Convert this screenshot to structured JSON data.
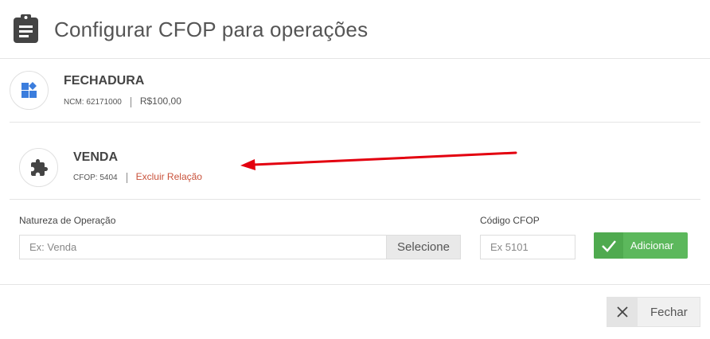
{
  "header": {
    "title": "Configurar CFOP para operações",
    "icon": "clipboard-icon"
  },
  "product": {
    "name": "FECHADURA",
    "ncm_label": "NCM: 62171000",
    "price": "R$100,00",
    "icon": "apps-icon",
    "icon_color": "#3b7ddd"
  },
  "relation": {
    "name": "VENDA",
    "cfop_label": "CFOP: 5404",
    "remove_link": "Excluir Relação",
    "icon": "puzzle-icon"
  },
  "form": {
    "natureza_label": "Natureza de Operação",
    "natureza_placeholder": "Ex: Venda",
    "select_button": "Selecione",
    "cfop_label": "Código CFOP",
    "cfop_placeholder": "Ex 5101",
    "add_button": "Adicionar"
  },
  "footer": {
    "close_button": "Fechar"
  },
  "colors": {
    "accent_green": "#5cb85c",
    "link_red": "#c9523b",
    "arrow_red": "#e3000f"
  }
}
